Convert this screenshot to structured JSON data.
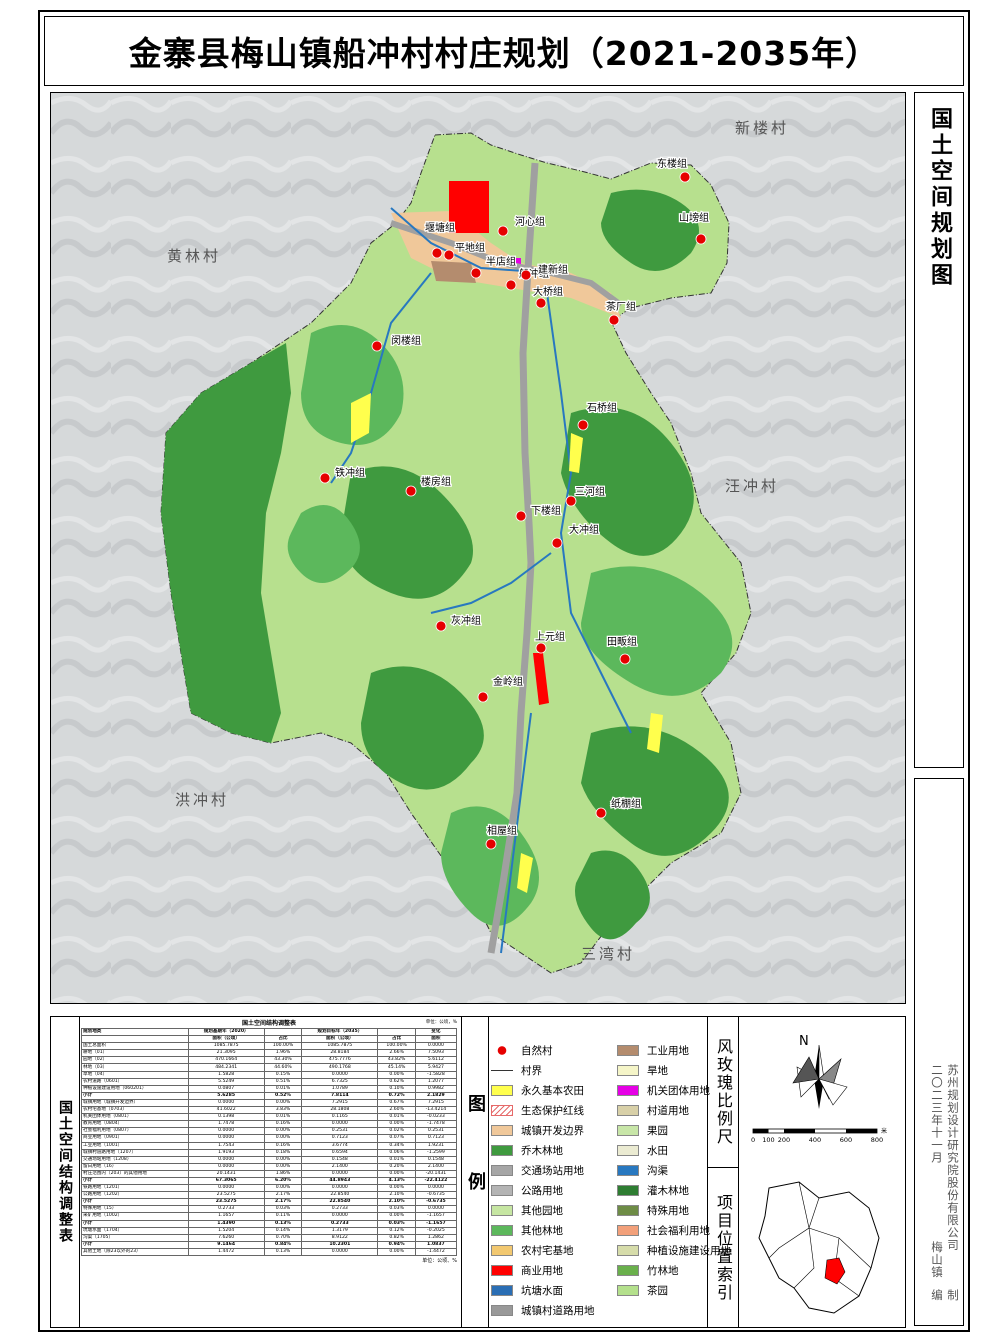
{
  "title": "金寨县梅山镇船冲村村庄规划（2021-2035年）",
  "right_title": "国土空间规划图",
  "credit": {
    "company": "苏州规划设计研究院股份有限公司",
    "date": "二〇二三年十一月",
    "town": "梅山镇",
    "role_a": "编",
    "role_b": "制"
  },
  "neighbors": {
    "n": "新楼村",
    "w1": "黄林村",
    "e": "汪冲村",
    "w2": "洪冲村",
    "s": "三湾村"
  },
  "groups": [
    "东楼组",
    "山塝组",
    "河心组",
    "堰塘组",
    "平地组",
    "半店组",
    "船冲组",
    "建新组",
    "大桥组",
    "茶厂组",
    "闵楼组",
    "石桥组",
    "铁冲组",
    "楼房组",
    "三河组",
    "下楼组",
    "大冲组",
    "灰冲组",
    "上元组",
    "田畈组",
    "金岭组",
    "纸棚组",
    "相屋组"
  ],
  "table": {
    "side_title": "国土空间结构调整表",
    "caption": "国土空间结构调整表",
    "unit": "单位：公顷，%",
    "header": [
      "规划地类",
      "规划基期年（2020）",
      "",
      "规划目标年（2035）",
      "",
      "变化"
    ],
    "subheader": [
      "",
      "面积（公顷）",
      "占比",
      "面积（公顷）",
      "占比",
      "面积"
    ],
    "rows": [
      [
        "国土总面积",
        "1085.7875",
        "100.00%",
        "1085.7875",
        "100.00%",
        "0.0000"
      ],
      [
        "耕地（01）",
        "21.3095",
        "1.96%",
        "28.8184",
        "2.66%",
        "7.5093"
      ],
      [
        "园地（02）",
        "470.1664",
        "43.30%",
        "475.7776",
        "43.82%",
        "5.6112"
      ],
      [
        "林地（03）",
        "484.2341",
        "44.60%",
        "490.1768",
        "45.14%",
        "5.9427"
      ],
      [
        "草地（04）",
        "1.5828",
        "0.15%",
        "0.0000",
        "0.00%",
        "-1.5828"
      ],
      [
        "农村道路（0601）",
        "5.5249",
        "0.51%",
        "6.7325",
        "0.62%",
        "1.2077"
      ],
      [
        "种植设施建设用地（060201）",
        "0.0807",
        "0.01%",
        "1.0789",
        "0.10%",
        "0.9982"
      ],
      [
        "小计",
        "5.6285",
        "0.52%",
        "7.8114",
        "0.72%",
        "2.1829"
      ],
      [
        "城镇用地（城镇开发边界）",
        "0.0000",
        "0.00%",
        "7.2915",
        "0.67%",
        "7.2915"
      ],
      [
        "农村宅基地（0703）",
        "41.6022",
        "3.83%",
        "28.1808",
        "2.60%",
        "-13.4214"
      ],
      [
        "机关团体用地（0801）",
        "0.1398",
        "0.01%",
        "0.1165",
        "0.01%",
        "-0.0233"
      ],
      [
        "教育用地（0804）",
        "1.7478",
        "0.16%",
        "0.0000",
        "0.00%",
        "-1.7478"
      ],
      [
        "社会福利用地（0807）",
        "0.0000",
        "0.00%",
        "0.2531",
        "0.02%",
        "0.2531"
      ],
      [
        "商业用地（0901）",
        "0.0000",
        "0.00%",
        "0.7123",
        "0.07%",
        "0.7123"
      ],
      [
        "工业用地（1001）",
        "1.7543",
        "0.16%",
        "3.6774",
        "0.34%",
        "1.9231"
      ],
      [
        "城镇村道路用地（1207）",
        "1.9193",
        "0.18%",
        "0.6594",
        "0.06%",
        "-1.2599"
      ],
      [
        "交通场站用地（1208）",
        "0.0000",
        "0.00%",
        "0.1548",
        "0.01%",
        "0.1548"
      ],
      [
        "留白用地（16）",
        "0.0000",
        "0.00%",
        "2.1400",
        "0.20%",
        "2.1400"
      ],
      [
        "村庄范围内（203）的其他用地",
        "20.1431",
        "1.86%",
        "0.0000",
        "0.00%",
        "-20.1431"
      ],
      [
        "小计",
        "67.3065",
        "6.20%",
        "44.8943",
        "4.13%",
        "-22.4122"
      ],
      [
        "铁路用地（1201）",
        "0.0000",
        "0.00%",
        "0.0000",
        "0.00%",
        "0.0000"
      ],
      [
        "公路用地（1202）",
        "23.5275",
        "2.17%",
        "22.8540",
        "2.10%",
        "-0.6735"
      ],
      [
        "小计",
        "23.5275",
        "2.17%",
        "22.8540",
        "2.10%",
        "-0.6735"
      ],
      [
        "特殊用地（15）",
        "0.2733",
        "0.03%",
        "0.2733",
        "0.03%",
        "0.0000"
      ],
      [
        "采矿用地（1002）",
        "1.1657",
        "0.11%",
        "0.0000",
        "0.00%",
        "-1.1657"
      ],
      [
        "小计",
        "1.4390",
        "0.13%",
        "0.2733",
        "0.03%",
        "-1.1657"
      ],
      [
        "坑塘水面（1704）",
        "1.5204",
        "0.14%",
        "1.3179",
        "0.12%",
        "-0.2025"
      ],
      [
        "沟渠（1705）",
        "7.6260",
        "0.70%",
        "8.9122",
        "0.82%",
        "1.2862"
      ],
      [
        "小计",
        "9.1464",
        "0.84%",
        "10.2301",
        "0.94%",
        "1.0837"
      ],
      [
        "其他土地（除23以外的23）",
        "1.4472",
        "0.13%",
        "0.0000",
        "0.00%",
        "-1.4472"
      ]
    ],
    "foot": "单位：公顷、%"
  },
  "legend_title": "图例",
  "legend": [
    {
      "label": "自然村",
      "type": "dot",
      "color": "#e60000"
    },
    {
      "label": "工业用地",
      "type": "fill",
      "color": "#b48c6e"
    },
    {
      "label": "村界",
      "type": "line",
      "color": "#333333"
    },
    {
      "label": "旱地",
      "type": "fill",
      "color": "#f5f5c8"
    },
    {
      "label": "永久基本农田",
      "type": "fill",
      "color": "#ffff4d"
    },
    {
      "label": "机关团体用地",
      "type": "fill",
      "color": "#e600e6"
    },
    {
      "label": "生态保护红线",
      "type": "hatch",
      "color": "#e66a6a"
    },
    {
      "label": "村道用地",
      "type": "fill",
      "color": "#d8d0a8"
    },
    {
      "label": "城镇开发边界",
      "type": "fill",
      "color": "#f0c89a"
    },
    {
      "label": "果园",
      "type": "fill",
      "color": "#c8e6a8"
    },
    {
      "label": "乔木林地",
      "type": "fill",
      "color": "#3f9a3f"
    },
    {
      "label": "水田",
      "type": "fill",
      "color": "#ebebd2"
    },
    {
      "label": "交通场站用地",
      "type": "fill",
      "color": "#a6a6a6"
    },
    {
      "label": "沟渠",
      "type": "fill",
      "color": "#2878c0"
    },
    {
      "label": "公路用地",
      "type": "fill",
      "color": "#b4b4b4"
    },
    {
      "label": "灌木林地",
      "type": "fill",
      "color": "#2e7d32"
    },
    {
      "label": "其他园地",
      "type": "fill",
      "color": "#c6e6a2"
    },
    {
      "label": "特殊用地",
      "type": "fill",
      "color": "#6e8c46"
    },
    {
      "label": "其他林地",
      "type": "fill",
      "color": "#5cb85c"
    },
    {
      "label": "社会福利用地",
      "type": "fill",
      "color": "#f2a07a"
    },
    {
      "label": "农村宅基地",
      "type": "fill",
      "color": "#f2c870"
    },
    {
      "label": "种植设施建设用地",
      "type": "fill",
      "color": "#d6dcaa"
    },
    {
      "label": "商业用地",
      "type": "fill",
      "color": "#ff0000"
    },
    {
      "label": "竹林地",
      "type": "fill",
      "color": "#6ab04c"
    },
    {
      "label": "坑塘水面",
      "type": "fill",
      "color": "#2a6eb4"
    },
    {
      "label": "茶园",
      "type": "fill",
      "color": "#b4e08c"
    },
    {
      "label": "城镇村道路用地",
      "type": "fill",
      "color": "#999999"
    }
  ],
  "compass_label": "风玫瑰比例尺",
  "north": "N",
  "scale": {
    "ticks": [
      "0",
      "100",
      "200",
      "400",
      "600",
      "800"
    ],
    "unit": "米"
  },
  "index_label": "项目位置索引"
}
